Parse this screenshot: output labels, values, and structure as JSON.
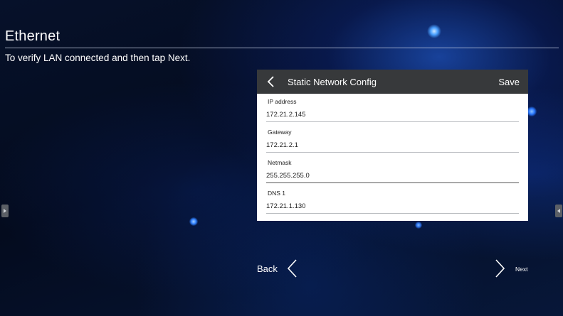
{
  "page": {
    "title": "Ethernet",
    "instruction": "To verify LAN connected and then tap Next."
  },
  "dialog": {
    "title": "Static Network Config",
    "save_label": "Save",
    "fields": [
      {
        "label": "IP address",
        "value": "172.21.2.145"
      },
      {
        "label": "Gateway",
        "value": "172.21.2.1"
      },
      {
        "label": "Netmask",
        "value": "255.255.255.0"
      },
      {
        "label": "DNS 1",
        "value": "172.21.1.130"
      }
    ]
  },
  "navigation": {
    "back_label": "Back",
    "next_label": "Next"
  },
  "icons": {
    "dialog_back": "chevron-left-icon",
    "nav_back": "chevron-left-icon",
    "nav_next": "chevron-right-icon",
    "left_handle": "triangle-right-icon",
    "right_handle": "triangle-left-icon"
  },
  "colors": {
    "dialog_header": "#37393b",
    "dialog_body": "#ffffff",
    "background": "#06112a"
  }
}
